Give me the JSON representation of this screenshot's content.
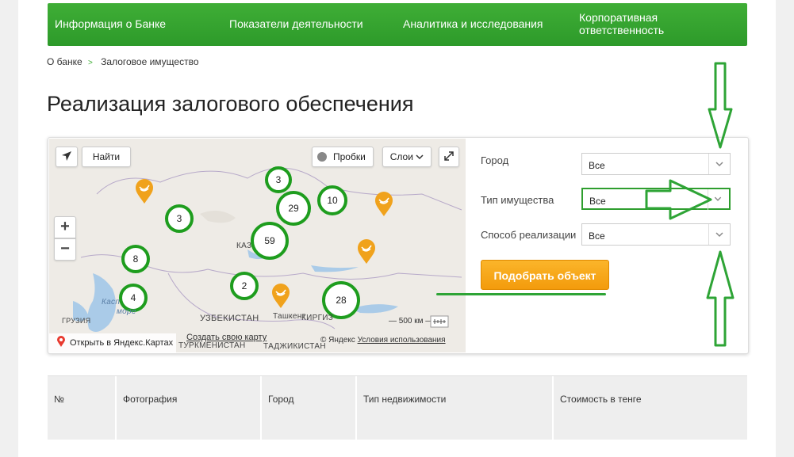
{
  "nav": {
    "items": [
      "Информация о Банке",
      "Показатели деятельности",
      "Аналитика и исследования",
      "Корпоративная ответственность"
    ]
  },
  "breadcrumb": {
    "parent": "О банке",
    "separator": ">",
    "current": "Залоговое имущество"
  },
  "page_title": "Реализация залогового обеспечения",
  "map": {
    "find_label": "Найти",
    "traffic_label": "Пробки",
    "layers_label": "Слои",
    "zoom_in": "+",
    "zoom_out": "−",
    "clusters": [
      "3",
      "3",
      "29",
      "10",
      "59",
      "8",
      "2",
      "4",
      "28"
    ],
    "labels": {
      "kaz": "КАЗ",
      "uzbekistan": "УЗБЕКИСТАН",
      "tashkent": "Ташкент",
      "kyrgyz": "КИРГИЗ",
      "turkmenistan": "ТУРКМЕНИСТАН",
      "tajikistan": "ТАДЖИКИСТАН",
      "georgia": "ГРУЗИЯ",
      "caspian_1": "Касп",
      "caspian_2": "море"
    },
    "scale": "500 км",
    "open_in_yandex": "Открыть в Яндекс.Картах",
    "create_map": "Создать свою карту",
    "copyright": "© Яндекс",
    "terms": "Условия использования",
    "brand_color": "#2e9e2e",
    "pin_color": "#f0a21c"
  },
  "filters": {
    "city": {
      "label": "Город",
      "value": "Все"
    },
    "property_type": {
      "label": "Тип имущества",
      "value": "Все"
    },
    "sale_method": {
      "label": "Способ реализации",
      "value": "Все"
    },
    "submit_label": "Подобрать объект"
  },
  "table": {
    "headers": [
      "№",
      "Фотография",
      "Город",
      "Тип недвижимости",
      "Стоимость в тенге"
    ]
  }
}
